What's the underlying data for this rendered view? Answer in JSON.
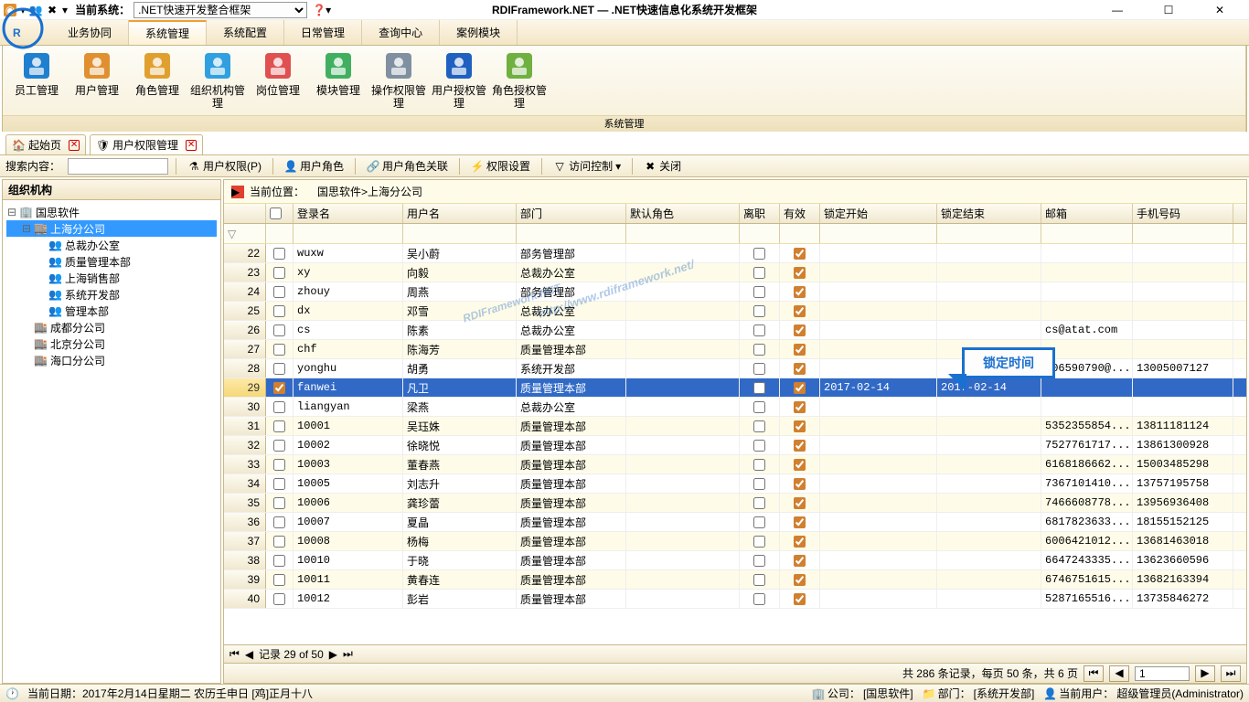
{
  "titlebar": {
    "system_label": "当前系统：",
    "system_value": ".NET快速开发整合框架",
    "app_title": "RDIFramework.NET — .NET快速信息化系统开发框架"
  },
  "menus": [
    "业务协同",
    "系统管理",
    "系统配置",
    "日常管理",
    "查询中心",
    "案例模块"
  ],
  "active_menu": 1,
  "ribbon": {
    "items": [
      {
        "label": "员工管理",
        "icon": "staff"
      },
      {
        "label": "用户管理",
        "icon": "user"
      },
      {
        "label": "角色管理",
        "icon": "role"
      },
      {
        "label": "组织机构管理",
        "icon": "org"
      },
      {
        "label": "岗位管理",
        "icon": "post"
      },
      {
        "label": "模块管理",
        "icon": "module"
      },
      {
        "label": "操作权限管理",
        "icon": "op"
      },
      {
        "label": "用户授权管理",
        "icon": "userauth"
      },
      {
        "label": "角色授权管理",
        "icon": "roleauth"
      }
    ],
    "group_label": "系统管理"
  },
  "doc_tabs": [
    {
      "label": "起始页",
      "icon": "home"
    },
    {
      "label": "用户权限管理",
      "icon": "shield"
    }
  ],
  "active_doc_tab": 1,
  "toolbar": {
    "search_label": "搜索内容：",
    "search_value": "",
    "items": [
      {
        "label": "用户权限(P)",
        "icon": "filter"
      },
      {
        "label": "用户角色",
        "icon": "userrole"
      },
      {
        "label": "用户角色关联",
        "icon": "link"
      },
      {
        "label": "权限设置",
        "icon": "bolt"
      },
      {
        "label": "访问控制",
        "icon": "funnel",
        "dropdown": true
      },
      {
        "label": "关闭",
        "icon": "close"
      }
    ]
  },
  "left": {
    "title": "组织机构",
    "tree": [
      {
        "label": "国思软件",
        "level": 0,
        "expanded": true,
        "icon": "company"
      },
      {
        "label": "上海分公司",
        "level": 1,
        "expanded": true,
        "selected": true,
        "icon": "branch"
      },
      {
        "label": "总裁办公室",
        "level": 2,
        "icon": "dept"
      },
      {
        "label": "质量管理本部",
        "level": 2,
        "icon": "dept"
      },
      {
        "label": "上海销售部",
        "level": 2,
        "icon": "dept"
      },
      {
        "label": "系统开发部",
        "level": 2,
        "icon": "dept"
      },
      {
        "label": "管理本部",
        "level": 2,
        "icon": "dept"
      },
      {
        "label": "成都分公司",
        "level": 1,
        "icon": "branch"
      },
      {
        "label": "北京分公司",
        "level": 1,
        "icon": "branch"
      },
      {
        "label": "海口分公司",
        "level": 1,
        "icon": "branch"
      }
    ]
  },
  "breadcrumb": {
    "prefix": "当前位置：",
    "path": "国思软件>上海分公司"
  },
  "grid": {
    "columns": [
      "",
      "",
      "登录名",
      "用户名",
      "部门",
      "默认角色",
      "离职",
      "有效",
      "锁定开始",
      "锁定结束",
      "邮箱",
      "手机号码"
    ],
    "rows": [
      {
        "n": 22,
        "sel": false,
        "login": "wuxw",
        "name": "吴小蔚",
        "dept": "部务管理部",
        "role": "",
        "leave": false,
        "valid": true,
        "lstart": "",
        "lend": "",
        "email": "",
        "phone": ""
      },
      {
        "n": 23,
        "sel": false,
        "login": "xy",
        "name": "向毅",
        "dept": "总裁办公室",
        "role": "",
        "leave": false,
        "valid": true,
        "lstart": "",
        "lend": "",
        "email": "",
        "phone": ""
      },
      {
        "n": 24,
        "sel": false,
        "login": "zhouy",
        "name": "周燕",
        "dept": "部务管理部",
        "role": "",
        "leave": false,
        "valid": true,
        "lstart": "",
        "lend": "",
        "email": "",
        "phone": ""
      },
      {
        "n": 25,
        "sel": false,
        "login": "dx",
        "name": "邓雪",
        "dept": "总裁办公室",
        "role": "",
        "leave": false,
        "valid": true,
        "lstart": "",
        "lend": "",
        "email": "",
        "phone": ""
      },
      {
        "n": 26,
        "sel": false,
        "login": "cs",
        "name": "陈素",
        "dept": "总裁办公室",
        "role": "",
        "leave": false,
        "valid": true,
        "lstart": "",
        "lend": "",
        "email": "cs@atat.com",
        "phone": ""
      },
      {
        "n": 27,
        "sel": false,
        "login": "chf",
        "name": "陈海芳",
        "dept": "质量管理本部",
        "role": "",
        "leave": false,
        "valid": true,
        "lstart": "",
        "lend": "",
        "email": "",
        "phone": ""
      },
      {
        "n": 28,
        "sel": false,
        "login": "yonghu",
        "name": "胡勇",
        "dept": "系统开发部",
        "role": "",
        "leave": false,
        "valid": true,
        "lstart": "",
        "lend": "",
        "email": "406590790@...",
        "phone": "13005007127"
      },
      {
        "n": 29,
        "sel": true,
        "login": "fanwei",
        "name": "凡卫",
        "dept": "质量管理本部",
        "role": "",
        "leave": false,
        "valid": true,
        "lstart": "2017-02-14",
        "lend": "2017-02-14",
        "email": "",
        "phone": "",
        "selected": true
      },
      {
        "n": 30,
        "sel": false,
        "login": "liangyan",
        "name": "梁燕",
        "dept": "总裁办公室",
        "role": "",
        "leave": false,
        "valid": true,
        "lstart": "",
        "lend": "",
        "email": "",
        "phone": ""
      },
      {
        "n": 31,
        "sel": false,
        "login": "10001",
        "name": "吴珏姝",
        "dept": "质量管理本部",
        "role": "",
        "leave": false,
        "valid": true,
        "lstart": "",
        "lend": "",
        "email": "5352355854...",
        "phone": "13811181124"
      },
      {
        "n": 32,
        "sel": false,
        "login": "10002",
        "name": "徐晓悦",
        "dept": "质量管理本部",
        "role": "",
        "leave": false,
        "valid": true,
        "lstart": "",
        "lend": "",
        "email": "7527761717...",
        "phone": "13861300928"
      },
      {
        "n": 33,
        "sel": false,
        "login": "10003",
        "name": "董春燕",
        "dept": "质量管理本部",
        "role": "",
        "leave": false,
        "valid": true,
        "lstart": "",
        "lend": "",
        "email": "6168186662...",
        "phone": "15003485298"
      },
      {
        "n": 34,
        "sel": false,
        "login": "10005",
        "name": "刘志升",
        "dept": "质量管理本部",
        "role": "",
        "leave": false,
        "valid": true,
        "lstart": "",
        "lend": "",
        "email": "7367101410...",
        "phone": "13757195758"
      },
      {
        "n": 35,
        "sel": false,
        "login": "10006",
        "name": "龚珍蕾",
        "dept": "质量管理本部",
        "role": "",
        "leave": false,
        "valid": true,
        "lstart": "",
        "lend": "",
        "email": "7466608778...",
        "phone": "13956936408"
      },
      {
        "n": 36,
        "sel": false,
        "login": "10007",
        "name": "夏晶",
        "dept": "质量管理本部",
        "role": "",
        "leave": false,
        "valid": true,
        "lstart": "",
        "lend": "",
        "email": "6817823633...",
        "phone": "18155152125"
      },
      {
        "n": 37,
        "sel": false,
        "login": "10008",
        "name": "杨梅",
        "dept": "质量管理本部",
        "role": "",
        "leave": false,
        "valid": true,
        "lstart": "",
        "lend": "",
        "email": "6006421012...",
        "phone": "13681463018"
      },
      {
        "n": 38,
        "sel": false,
        "login": "10010",
        "name": "于晓",
        "dept": "质量管理本部",
        "role": "",
        "leave": false,
        "valid": true,
        "lstart": "",
        "lend": "",
        "email": "6647243335...",
        "phone": "13623660596"
      },
      {
        "n": 39,
        "sel": false,
        "login": "10011",
        "name": "黄春连",
        "dept": "质量管理本部",
        "role": "",
        "leave": false,
        "valid": true,
        "lstart": "",
        "lend": "",
        "email": "6746751615...",
        "phone": "13682163394"
      },
      {
        "n": 40,
        "sel": false,
        "login": "10012",
        "name": "彭岩",
        "dept": "质量管理本部",
        "role": "",
        "leave": false,
        "valid": true,
        "lstart": "",
        "lend": "",
        "email": "5287165516...",
        "phone": "13735846272"
      }
    ],
    "record_label": "记录 29 of 50",
    "pager_text": "共 286 条记录，每页 50 条，共 6 页",
    "pager_value": "1"
  },
  "callout": "锁定时间",
  "status": {
    "date": "当前日期：2017年2月14日星期二 农历壬申日 [鸡]正月十八",
    "company_lbl": "公司：",
    "company": "[国思软件]",
    "dept_lbl": "部门：",
    "dept": "[系统开发部]",
    "user_lbl": "当前用户：",
    "user": "超级管理员(Administrator)"
  },
  "watermark": {
    "main": "RDIFramework.NET",
    "sub": "http://www.rdiframework.net/"
  }
}
